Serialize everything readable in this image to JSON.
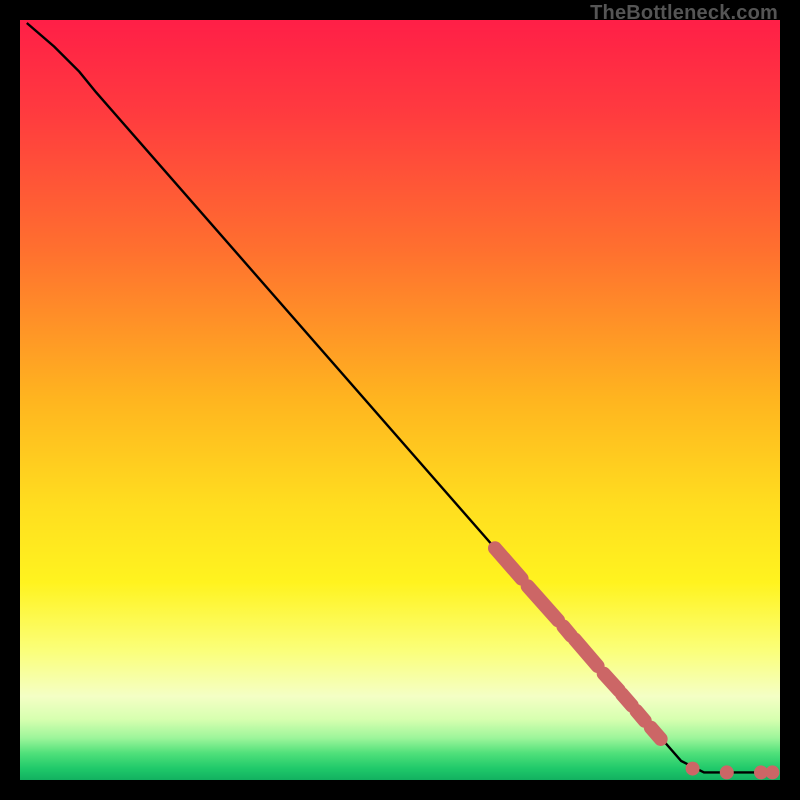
{
  "attribution": "TheBottleneck.com",
  "chart_data": {
    "type": "line",
    "title": "",
    "xlabel": "",
    "ylabel": "",
    "xlim": [
      0,
      100
    ],
    "ylim": [
      0,
      100
    ],
    "gradient_stops": [
      {
        "offset": 0.0,
        "color": "#ff1f47"
      },
      {
        "offset": 0.12,
        "color": "#ff3a3f"
      },
      {
        "offset": 0.3,
        "color": "#ff6f2f"
      },
      {
        "offset": 0.5,
        "color": "#ffb51f"
      },
      {
        "offset": 0.64,
        "color": "#ffde1f"
      },
      {
        "offset": 0.74,
        "color": "#fff31f"
      },
      {
        "offset": 0.83,
        "color": "#fbff7a"
      },
      {
        "offset": 0.89,
        "color": "#f4ffc5"
      },
      {
        "offset": 0.92,
        "color": "#d7ffb0"
      },
      {
        "offset": 0.945,
        "color": "#9cf59a"
      },
      {
        "offset": 0.965,
        "color": "#4fe07a"
      },
      {
        "offset": 0.985,
        "color": "#1fc96a"
      },
      {
        "offset": 1.0,
        "color": "#12b060"
      }
    ],
    "series": [
      {
        "name": "bottleneck-curve",
        "type": "line",
        "points": [
          {
            "x": 0.9,
            "y": 99.6
          },
          {
            "x": 4.5,
            "y": 96.5
          },
          {
            "x": 7.8,
            "y": 93.2
          },
          {
            "x": 10.0,
            "y": 90.5
          },
          {
            "x": 87.0,
            "y": 2.5
          },
          {
            "x": 90.0,
            "y": 1.0
          },
          {
            "x": 99.0,
            "y": 1.0
          }
        ]
      },
      {
        "name": "highlight-segments",
        "type": "line_overlay",
        "stroke": "#cc6666",
        "stroke_width": 14,
        "segments": [
          {
            "x1": 62.5,
            "y1": 30.5,
            "x2": 66.0,
            "y2": 26.5
          },
          {
            "x1": 66.8,
            "y1": 25.5,
            "x2": 70.8,
            "y2": 21.0
          },
          {
            "x1": 71.5,
            "y1": 20.2,
            "x2": 72.5,
            "y2": 19.0
          },
          {
            "x1": 73.0,
            "y1": 18.5,
            "x2": 76.0,
            "y2": 15.0
          },
          {
            "x1": 76.8,
            "y1": 14.0,
            "x2": 78.8,
            "y2": 11.8
          },
          {
            "x1": 79.2,
            "y1": 11.3,
            "x2": 80.5,
            "y2": 9.8
          },
          {
            "x1": 81.1,
            "y1": 9.1,
            "x2": 82.2,
            "y2": 7.8
          },
          {
            "x1": 83.0,
            "y1": 6.9,
            "x2": 84.3,
            "y2": 5.4
          }
        ]
      },
      {
        "name": "highlight-dots",
        "type": "scatter_overlay",
        "fill": "#cc6666",
        "radius": 7,
        "points": [
          {
            "x": 88.5,
            "y": 1.5
          },
          {
            "x": 93.0,
            "y": 1.0
          },
          {
            "x": 97.5,
            "y": 1.0
          },
          {
            "x": 99.0,
            "y": 1.0
          }
        ]
      }
    ]
  }
}
